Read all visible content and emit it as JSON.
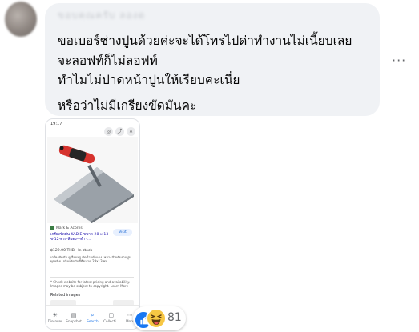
{
  "comment": {
    "author_name": "ขอบคุณครับ ลองดู",
    "lines": [
      "ขอเบอร์ช่างปูนด้วยค่ะจะได้โทรไปด่าทำงานไม่เนี้ยบเลย",
      "จะลอฟท์ก็ไม่ลอฟท์",
      "ทำไมไม่ปาดหน้าปูนให้เรียบคะเนี่ย",
      "หรือว่าไม่มีเกรียงขัดมันคะ"
    ],
    "more_options": "···"
  },
  "attachment": {
    "status_time": "19:17",
    "source": "Mark & Acorns",
    "product_title": "เกรียงขัดมัน KADIE-ขนาด-28-x-13-ซ-12-ตรง-สีแดง—ดำ -...",
    "price": "฿129.00 THB · In stock",
    "description": "เกรียงขัดมัน ดูเรียบหรู ขัดด้ามดำแดง เหมาะสำหรับงานปูนทุกชนิด เกรียงขัดมันดีดีขนาด 28x13 ซม.",
    "visit_label": "Visit",
    "notice": "* Check website for latest pricing and availability. Images may be subject to copyright. Learn More",
    "related_label": "Related images",
    "nav": [
      {
        "label": "Discover",
        "icon": "discover-icon",
        "glyph": "✳"
      },
      {
        "label": "Snapshot",
        "icon": "snapshot-icon",
        "glyph": "▤"
      },
      {
        "label": "Search",
        "icon": "search-icon",
        "glyph": "⌕"
      },
      {
        "label": "Collecti...",
        "icon": "collections-icon",
        "glyph": "▢"
      },
      {
        "label": "More",
        "icon": "more-icon",
        "glyph": "⋯"
      }
    ]
  },
  "reactions": {
    "count": "81",
    "types": [
      "like",
      "haha"
    ]
  },
  "colors": {
    "bubble": "#f0f2f5",
    "like": "#1877f2",
    "haha": "#f7c744",
    "trowel_handle": "#d6332e"
  }
}
